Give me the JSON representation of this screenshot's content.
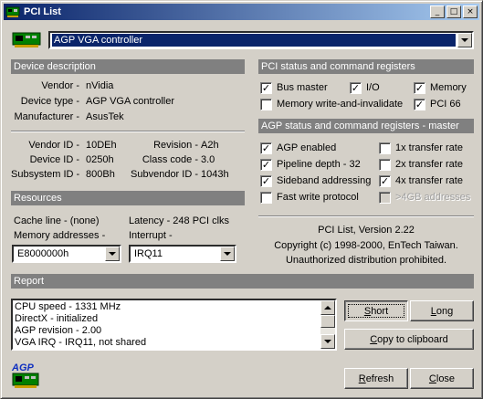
{
  "window": {
    "title": "PCI List"
  },
  "titlebar_buttons": {
    "minimize": "_",
    "maximize": "□",
    "close": "×"
  },
  "device_combo": {
    "value": "AGP VGA controller"
  },
  "device_description": {
    "header": "Device description",
    "rows": [
      {
        "label": "Vendor -",
        "value": "nVidia"
      },
      {
        "label": "Device type -",
        "value": "AGP VGA controller"
      },
      {
        "label": "Manufacturer -",
        "value": "AsusTek"
      }
    ],
    "ids": [
      {
        "label": "Vendor ID -",
        "value": "10DEh",
        "label2": "Revision -",
        "value2": "A2h"
      },
      {
        "label": "Device ID -",
        "value": "0250h",
        "label2": "Class code -",
        "value2": "3.0"
      },
      {
        "label": "Subsystem ID -",
        "value": "800Bh",
        "label2": "Subvendor ID -",
        "value2": "1043h"
      }
    ]
  },
  "resources": {
    "header": "Resources",
    "cache_line": "Cache line - (none)",
    "latency": "Latency - 248 PCI clks",
    "memory_label": "Memory addresses -",
    "interrupt_label": "Interrupt -",
    "memory_value": "E8000000h",
    "interrupt_value": "IRQ11"
  },
  "pci_status": {
    "header": "PCI status and command registers",
    "items": [
      {
        "label": "Bus master",
        "checked": true
      },
      {
        "label": "I/O",
        "checked": true
      },
      {
        "label": "Memory",
        "checked": true
      },
      {
        "label": "Memory write-and-invalidate",
        "checked": false
      },
      {
        "label": "PCI 66",
        "checked": true
      }
    ]
  },
  "agp_status": {
    "header": "AGP status and command registers - master",
    "left": [
      {
        "label": "AGP enabled",
        "checked": true
      },
      {
        "label": "Pipeline depth - 32",
        "checked": true
      },
      {
        "label": "Sideband addressing",
        "checked": true
      },
      {
        "label": "Fast write protocol",
        "checked": false
      }
    ],
    "right": [
      {
        "label": "1x transfer rate",
        "checked": false
      },
      {
        "label": "2x transfer rate",
        "checked": false
      },
      {
        "label": "4x transfer rate",
        "checked": true
      },
      {
        "label": ">4GB addresses",
        "checked": false,
        "disabled": true
      }
    ]
  },
  "about": {
    "line1": "PCI List, Version 2.22",
    "line2": "Copyright (c) 1998-2000, EnTech Taiwan.",
    "line3": "Unauthorized distribution prohibited."
  },
  "report": {
    "header": "Report",
    "lines": [
      "CPU speed - 1331 MHz",
      "DirectX - initialized",
      "AGP revision - 2.00",
      "VGA IRQ - IRQ11, not shared"
    ]
  },
  "buttons": {
    "short": {
      "acc": "S",
      "rest": "hort"
    },
    "long": {
      "acc": "L",
      "rest": "ong"
    },
    "copy": {
      "pre": "",
      "acc": "C",
      "rest": "opy to clipboard"
    },
    "refresh": {
      "acc": "R",
      "rest": "efresh"
    },
    "close": {
      "acc": "C",
      "rest": "lose"
    }
  },
  "logo": {
    "text": "AGP"
  },
  "colors": {
    "title_start": "#0a246a",
    "title_end": "#a6caf0",
    "face": "#d4d0c8",
    "header": "#808080"
  }
}
